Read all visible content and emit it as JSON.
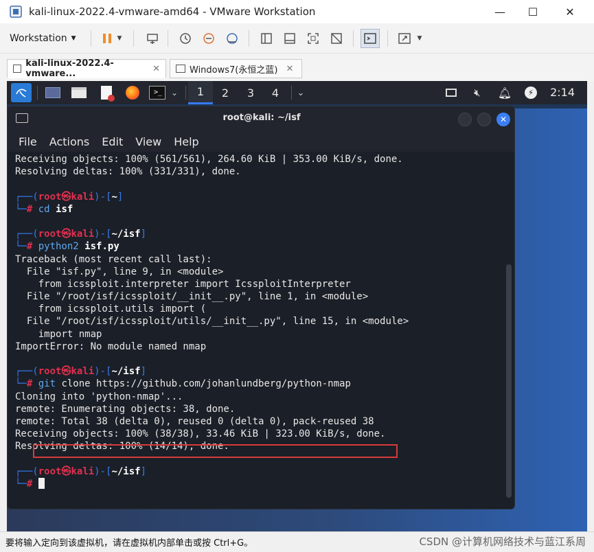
{
  "window": {
    "title": "kali-linux-2022.4-vmware-amd64 - VMware Workstation",
    "minimize": "—",
    "maximize": "☐",
    "close": "✕"
  },
  "toolbar": {
    "workstation_label": "Workstation",
    "icons": [
      "pause-icon",
      "send-keys-icon",
      "snapshot-icon",
      "revert-snapshot-icon",
      "snapshot-manager-icon",
      "sidebar-view-icon",
      "thumbnail-view-icon",
      "fullscreen-icon",
      "unity-icon",
      "console-view-icon",
      "stretch-icon"
    ]
  },
  "tabs": [
    {
      "label": "kali-linux-2022.4-vmware...",
      "active": true
    },
    {
      "label": "Windows7(永恒之蓝)",
      "active": false
    }
  ],
  "kali_panel": {
    "workspaces": [
      "1",
      "2",
      "3",
      "4"
    ],
    "active_workspace": "1",
    "clock": "2:14"
  },
  "terminal": {
    "title": "root@kali: ~/isf",
    "menu": [
      "File",
      "Actions",
      "Edit",
      "View",
      "Help"
    ],
    "lines": [
      {
        "type": "out",
        "text": "Receiving objects: 100% (561/561), 264.60 KiB | 353.00 KiB/s, done."
      },
      {
        "type": "out",
        "text": "Resolving deltas: 100% (331/331), done."
      },
      {
        "type": "blank",
        "text": ""
      },
      {
        "type": "prompt",
        "user": "root",
        "host": "kali",
        "path": "~"
      },
      {
        "type": "cmd",
        "cmd": "cd",
        "args": "isf"
      },
      {
        "type": "blank",
        "text": ""
      },
      {
        "type": "prompt",
        "user": "root",
        "host": "kali",
        "path": "~/isf"
      },
      {
        "type": "cmd",
        "cmd": "python2",
        "args": "isf.py"
      },
      {
        "type": "out",
        "text": "Traceback (most recent call last):"
      },
      {
        "type": "out",
        "text": "  File \"isf.py\", line 9, in <module>"
      },
      {
        "type": "out",
        "text": "    from icssploit.interpreter import IcssploitInterpreter"
      },
      {
        "type": "out",
        "text": "  File \"/root/isf/icssploit/__init__.py\", line 1, in <module>"
      },
      {
        "type": "out",
        "text": "    from icssploit.utils import ("
      },
      {
        "type": "out",
        "text": "  File \"/root/isf/icssploit/utils/__init__.py\", line 15, in <module>"
      },
      {
        "type": "out",
        "text": "    import nmap"
      },
      {
        "type": "out",
        "text": "ImportError: No module named nmap"
      },
      {
        "type": "blank",
        "text": ""
      },
      {
        "type": "prompt",
        "user": "root",
        "host": "kali",
        "path": "~/isf"
      },
      {
        "type": "cmd",
        "cmd": "git",
        "args": "clone https://github.com/johanlundberg/python-nmap",
        "plain": true
      },
      {
        "type": "out",
        "text": "Cloning into 'python-nmap'..."
      },
      {
        "type": "out",
        "text": "remote: Enumerating objects: 38, done."
      },
      {
        "type": "out",
        "text": "remote: Total 38 (delta 0), reused 0 (delta 0), pack-reused 38"
      },
      {
        "type": "out",
        "text": "Receiving objects: 100% (38/38), 33.46 KiB | 323.00 KiB/s, done."
      },
      {
        "type": "out",
        "text": "Resolving deltas: 100% (14/14), done."
      },
      {
        "type": "blank",
        "text": ""
      },
      {
        "type": "prompt",
        "user": "root",
        "host": "kali",
        "path": "~/isf"
      },
      {
        "type": "cursor",
        "text": ""
      }
    ]
  },
  "status": {
    "text": "要将输入定向到该虚拟机，请在虚拟机内部单击或按 Ctrl+G。",
    "watermark": "CSDN @计算机网络技术与蓝江系周"
  },
  "colors": {
    "prompt_frame": "#367bf0",
    "prompt_user": "#e0304f",
    "command": "#5ea9f2",
    "highlight_box": "#d63b3b"
  }
}
